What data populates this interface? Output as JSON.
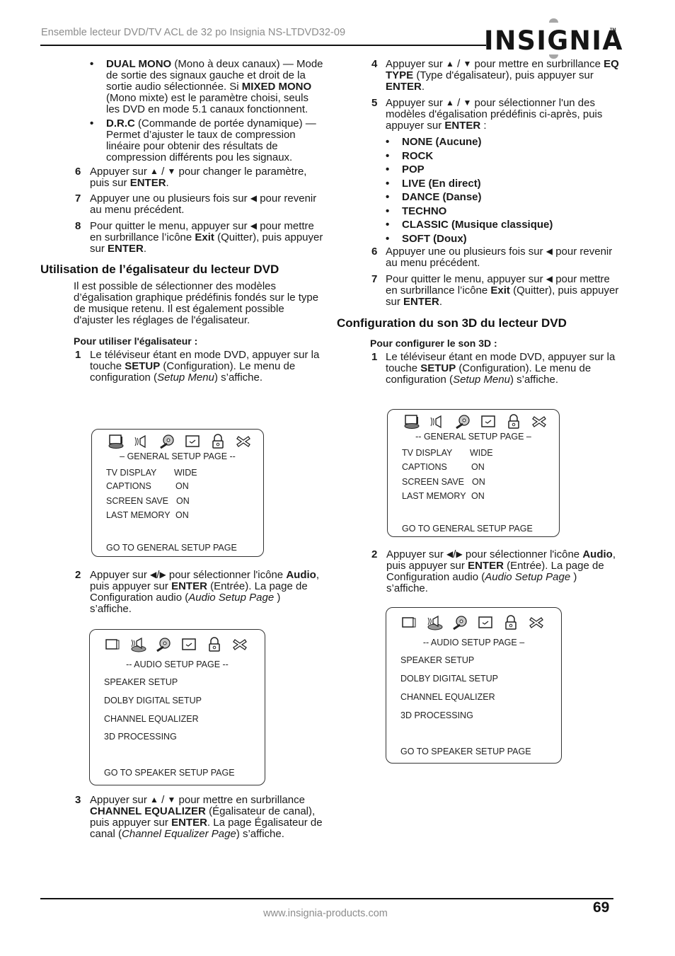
{
  "header": {
    "title": "Ensemble lecteur DVD/TV ACL de 32 po Insignia NS-LTDVD32-09",
    "logo": "INSIGNIA",
    "logo_tm": "TM"
  },
  "glyphs": {
    "up": "▲",
    "down": "▼",
    "left": "◀",
    "right": "▶",
    "slash": "/",
    "bullet": "•"
  },
  "left": {
    "bullets": [
      {
        "bold": "DUAL MONO",
        "text1": " (Mono à deux canaux) — Mode de sortie des signaux gauche et droit de la sortie audio sélectionnée. Si ",
        "bold2": "MIXED MONO",
        "text2": " (Mono mixte) est le paramètre choisi, seuls les DVD en mode 5.1 canaux fonctionnent."
      },
      {
        "bold": "D.R.C",
        "text1": " (Commande de portée dynamique) — Permet d’ajuster le taux de compression linéaire pour obtenir des résultats de compression différents pou les signaux."
      }
    ],
    "step6": {
      "num": "6",
      "a": "Appuyer sur ",
      "b": " pour changer le paramètre, puis sur ",
      "enter": "ENTER",
      "c": "."
    },
    "step7": {
      "num": "7",
      "a": "Appuyer une ou plusieurs fois sur ",
      "b": " pour revenir au menu précédent."
    },
    "step8": {
      "num": "8",
      "a": "Pour quitter le menu, appuyer sur ",
      "b": " pour mettre en surbrillance l’icône ",
      "exit": "Exit",
      "c": " (Quitter), puis appuyer sur ",
      "enter": "ENTER",
      "d": "."
    },
    "section_heading": "Utilisation de l’égalisateur du lecteur DVD",
    "intro": "Il est possible de sélectionner des modèles d’égalisation graphique prédéfinis fondés sur le type de musique retenu. Il est également possible d'ajuster les réglages de l'égalisateur.",
    "subhead": "Pour utiliser l'égalisateur :",
    "step1": {
      "num": "1",
      "a": "Le téléviseur étant en mode DVD, appuyer sur la touche ",
      "setup": "SETUP",
      "b": " (Configuration). Le menu de configuration (",
      "menu": "Setup Menu",
      "c": ") s’affiche."
    },
    "step2": {
      "num": "2",
      "a": "Appuyer sur ",
      "b": " pour sélectionner l'icône ",
      "audio": "Audio",
      "c": ", puis appuyer sur ",
      "enter": "ENTER",
      "d": " (Entrée). La page de Configuration audio (",
      "page": "Audio Setup Page",
      "e": " ) s’affiche."
    },
    "step3": {
      "num": "3",
      "a": "Appuyer sur ",
      "b": " pour mettre en surbrillance ",
      "ce": "CHANNEL EQUALIZER",
      "c": " (Égalisateur de canal), puis appuyer sur ",
      "enter": "ENTER",
      "d": ". La page Égalisateur de canal (",
      "page": "Channel Equalizer Page",
      "e": ") s’affiche."
    }
  },
  "right": {
    "step4": {
      "num": "4",
      "a": "Appuyer sur ",
      "b": " pour mettre en surbrillance ",
      "eq": "EQ TYPE",
      "c": " (Type d'égalisateur), puis appuyer sur ",
      "enter": "ENTER",
      "d": "."
    },
    "step5": {
      "num": "5",
      "a": "Appuyer sur ",
      "b": " pour sélectionner l'un des modèles d'égalisation prédéfinis ci-après, puis appuyer sur ",
      "enter": "ENTER",
      "c": " :"
    },
    "eq_presets": [
      "NONE (Aucune)",
      "ROCK",
      "POP",
      "LIVE (En direct)",
      "DANCE (Danse)",
      "TECHNO",
      "CLASSIC (Musique classique)",
      "SOFT (Doux)"
    ],
    "step6": {
      "num": "6",
      "a": "Appuyer une ou plusieurs fois sur ",
      "b": " pour revenir au menu précédent."
    },
    "step7": {
      "num": "7",
      "a": "Pour quitter le menu, appuyer sur ",
      "b": " pour mettre en surbrillance l’icône ",
      "exit": "Exit",
      "c": " (Quitter), puis appuyer sur ",
      "enter": "ENTER",
      "d": "."
    },
    "section_heading": "Configuration du son 3D du lecteur DVD",
    "subhead": "Pour configurer le son 3D :",
    "step1": {
      "num": "1",
      "a": "Le téléviseur étant en mode DVD, appuyer sur la touche ",
      "setup": "SETUP",
      "b": " (Configuration). Le menu de configuration (",
      "menu": "Setup Menu",
      "c": ") s’affiche."
    },
    "step2": {
      "num": "2",
      "a": "Appuyer sur ",
      "b": " pour sélectionner l'icône ",
      "audio": "Audio",
      "c": ", puis appuyer sur ",
      "enter": "ENTER",
      "d": " (Entrée). La page de Configuration audio (",
      "page": "Audio Setup Page",
      "e": " ) s’affiche."
    }
  },
  "osd_general_left": {
    "icons": [
      "tv-icon",
      "speaker-icon",
      "film-reel-icon",
      "screen-check-icon",
      "lock-icon",
      "exit-x-icon"
    ],
    "title": "–  GENERAL SETUP PAGE --",
    "rows": [
      {
        "label": "TV DISPLAY",
        "value": "WIDE"
      },
      {
        "label": "CAPTIONS",
        "value": "ON"
      },
      {
        "label": "SCREEN SAVE",
        "value": "ON"
      },
      {
        "label": "LAST MEMORY",
        "value": "ON"
      }
    ],
    "footer": "GO TO GENERAL SETUP PAGE"
  },
  "osd_audio_left": {
    "title": "-- AUDIO SETUP PAGE --",
    "items": [
      "SPEAKER SETUP",
      "DOLBY DIGITAL SETUP",
      "CHANNEL EQUALIZER",
      "3D PROCESSING"
    ],
    "footer": "GO TO SPEAKER SETUP PAGE"
  },
  "osd_general_right": {
    "title": "--  GENERAL SETUP PAGE –",
    "rows": [
      {
        "label": "TV DISPLAY",
        "value": "WIDE"
      },
      {
        "label": "CAPTIONS",
        "value": "ON"
      },
      {
        "label": "SCREEN SAVE",
        "value": "ON"
      },
      {
        "label": "LAST MEMORY",
        "value": "ON"
      }
    ],
    "footer": "GO TO GENERAL SETUP PAGE"
  },
  "osd_audio_right": {
    "title": "-- AUDIO SETUP PAGE –",
    "items": [
      "SPEAKER SETUP",
      "DOLBY DIGITAL SETUP",
      "CHANNEL EQUALIZER",
      "3D PROCESSING"
    ],
    "footer": "GO TO SPEAKER SETUP PAGE"
  },
  "footer": {
    "url": "www.insignia-products.com",
    "page_number": "69"
  }
}
